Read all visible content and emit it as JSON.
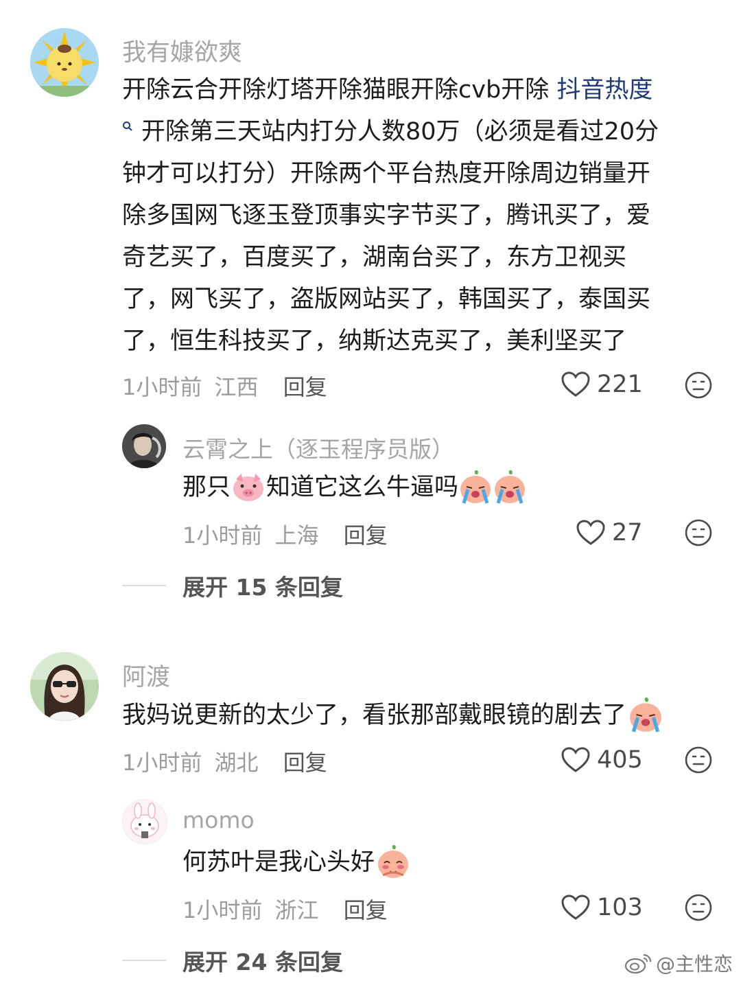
{
  "comments": [
    {
      "user": "我有嫝欲爽",
      "avatar_icon": "sun-pudding-avatar",
      "text_lines": [
        "开除云合开除灯塔开除猫眼开除cvb开除",
        "开除第三天站内打分人数80万（必须是看过20分",
        "钟才可以打分）开除两个平台热度开除周边销量开",
        "除多国网飞逐玉登顶事实字节买了，腾讯买了，爱",
        "奇艺买了，百度买了，湖南台买了，东方卫视买",
        "了，网飞买了，盗版网站买了，韩国买了，泰国买",
        "了，恒生科技买了，纳斯达克买了，美利坚买了"
      ],
      "search_link": "抖音热度",
      "time": "1小时前",
      "location": "江西",
      "reply_label": "回复",
      "likes": "221",
      "replies": [
        {
          "user": "云霄之上（逐玉程序员版）",
          "text_before": "那只",
          "text_after": "知道它这么牛逼吗",
          "emojis": [
            "pig-face-emoji",
            "crying-peach-emoji",
            "crying-peach-emoji"
          ],
          "time": "1小时前",
          "location": "上海",
          "reply_label": "回复",
          "likes": "27"
        }
      ],
      "expand_label": "展开 15 条回复"
    },
    {
      "user": "阿渡",
      "text": "我妈说更新的太少了，看张那部戴眼镜的剧去了",
      "emojis": [
        "crying-peach-emoji"
      ],
      "time": "1小时前",
      "location": "湖北",
      "reply_label": "回复",
      "likes": "405",
      "replies": [
        {
          "user": "momo",
          "text": "何苏叶是我心头好",
          "emojis": [
            "shy-peach-emoji"
          ],
          "time": "1小时前",
          "location": "浙江",
          "reply_label": "回复",
          "likes": "103"
        }
      ],
      "expand_label": "展开 24 条回复"
    }
  ],
  "watermark": "@主性恋"
}
